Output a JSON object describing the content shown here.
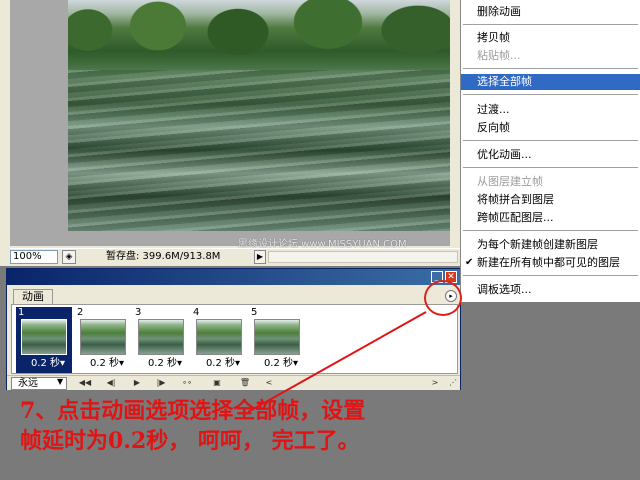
{
  "doc_window": {
    "zoom": "100%",
    "scratch_disk": "暂存盘: 399.6M/913.8M",
    "watermark": "思缘设计论坛  www.MISSYUAN.COM"
  },
  "palette": {
    "tab_label": "动画",
    "frames": [
      {
        "num": "1",
        "delay": "0.2 秒▾"
      },
      {
        "num": "2",
        "delay": "0.2 秒▾"
      },
      {
        "num": "3",
        "delay": "0.2 秒▾"
      },
      {
        "num": "4",
        "delay": "0.2 秒▾"
      },
      {
        "num": "5",
        "delay": "0.2 秒▾"
      }
    ],
    "loop": "永远"
  },
  "context_menu": {
    "items": [
      {
        "label": "删除动画",
        "state": "normal"
      },
      {
        "label": "拷贝帧",
        "state": "normal"
      },
      {
        "label": "粘贴帧...",
        "state": "disabled"
      },
      {
        "label": "选择全部帧",
        "state": "highlighted"
      },
      {
        "label": "过渡...",
        "state": "normal"
      },
      {
        "label": "反向帧",
        "state": "normal"
      },
      {
        "label": "优化动画...",
        "state": "normal"
      },
      {
        "label": "从图层建立帧",
        "state": "disabled"
      },
      {
        "label": "将帧拼合到图层",
        "state": "normal"
      },
      {
        "label": "跨帧匹配图层...",
        "state": "normal"
      },
      {
        "label": "为每个新建帧创建新图层",
        "state": "normal"
      },
      {
        "label": "新建在所有帧中都可见的图层",
        "state": "checked"
      },
      {
        "label": "调板选项...",
        "state": "normal"
      }
    ]
  },
  "caption": {
    "line1": "7、点击动画选项选择全部帧，设置",
    "line2": "帧延时为0.2秒，  呵呵，  完工了。"
  },
  "colors": {
    "highlight": "#316ac5",
    "annotation": "#e01414"
  }
}
